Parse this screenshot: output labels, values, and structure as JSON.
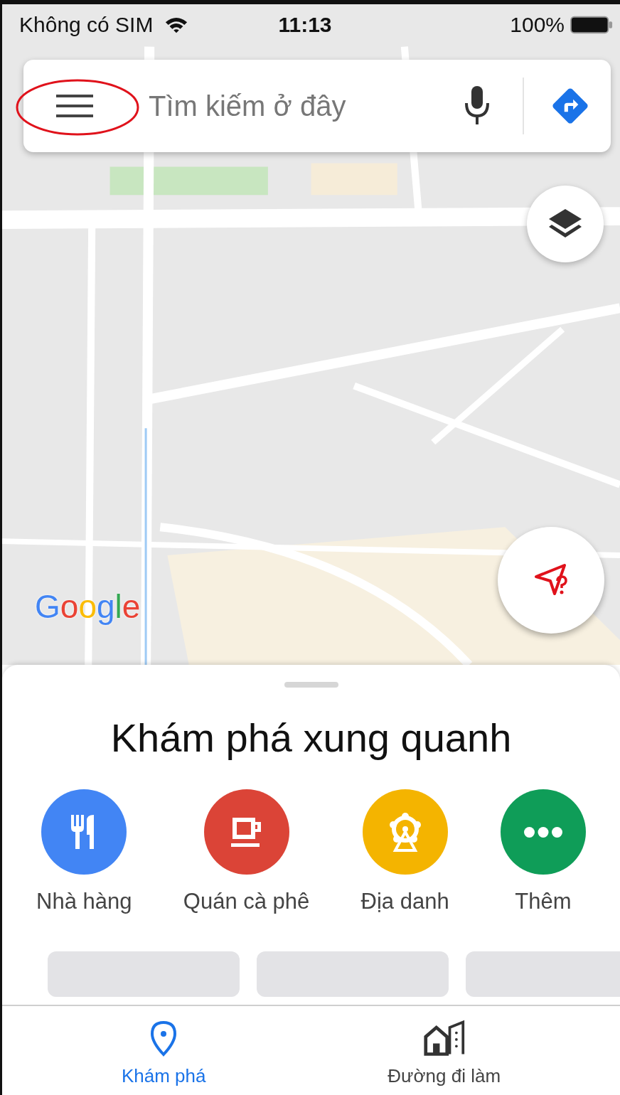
{
  "status_bar": {
    "carrier": "Không có SIM",
    "time": "11:13",
    "battery": "100%"
  },
  "search": {
    "placeholder": "Tìm kiếm ở đây"
  },
  "map": {
    "logo": "Google"
  },
  "sheet": {
    "title": "Khám phá xung quanh",
    "categories": [
      {
        "label": "Nhà hàng",
        "kind": "restaurant",
        "color": "#4285f4"
      },
      {
        "label": "Quán cà phê",
        "kind": "cafe",
        "color": "#db4437"
      },
      {
        "label": "Địa danh",
        "kind": "landmark",
        "color": "#f4b400"
      },
      {
        "label": "Thêm",
        "kind": "more",
        "color": "#0f9d58"
      }
    ]
  },
  "tabs": [
    {
      "label": "Khám phá",
      "kind": "explore",
      "selected": true
    },
    {
      "label": "Đường đi làm",
      "kind": "commute",
      "selected": false
    }
  ]
}
